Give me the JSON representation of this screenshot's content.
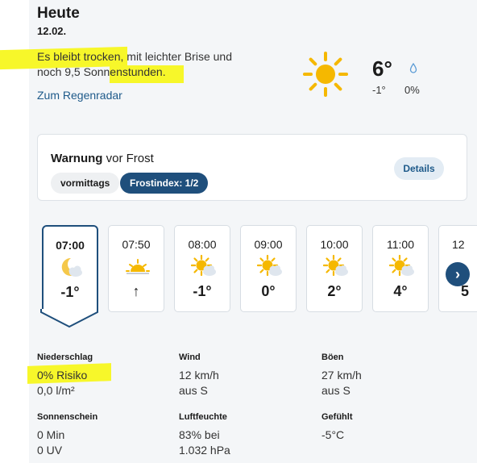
{
  "header": {
    "title": "Heute",
    "date": "12.02."
  },
  "summary": {
    "text_a": "Es bleibt trocken, mit leichter Brise und",
    "text_b": "noch ",
    "text_c": "9,5 Sonnenstunden.",
    "radar_link": "Zum Regenradar"
  },
  "current": {
    "temp": "6°",
    "min": "-1°",
    "precip": "0%",
    "icon": "sun-icon"
  },
  "warning": {
    "title_bold": "Warnung",
    "title_rest": " vor Frost",
    "chip_time": "vormittags",
    "chip_index": "Frostindex: 1/2",
    "details_label": "Details"
  },
  "hourly": [
    {
      "time": "07:00",
      "temp": "-1°",
      "icon": "moon-cloud-icon",
      "selected": true
    },
    {
      "time": "07:50",
      "temp": "↑",
      "icon": "sunrise-icon",
      "selected": false
    },
    {
      "time": "08:00",
      "temp": "-1°",
      "icon": "sun-cloud-icon",
      "selected": false
    },
    {
      "time": "09:00",
      "temp": "0°",
      "icon": "sun-cloud-icon",
      "selected": false
    },
    {
      "time": "10:00",
      "temp": "2°",
      "icon": "sun-cloud-icon",
      "selected": false
    },
    {
      "time": "11:00",
      "temp": "4°",
      "icon": "sun-cloud-icon",
      "selected": false
    },
    {
      "time": "12",
      "temp": "5",
      "icon": "sun-cloud-icon",
      "selected": false
    }
  ],
  "next_button": "›",
  "details": {
    "niederschlag": {
      "label": "Niederschlag",
      "line1": "0% Risiko",
      "line2": "0,0 l/m²"
    },
    "wind": {
      "label": "Wind",
      "line1": "12 km/h",
      "line2": "aus S"
    },
    "boeen": {
      "label": "Böen",
      "line1": "27 km/h",
      "line2": "aus S"
    },
    "sonnenschein": {
      "label": "Sonnenschein",
      "line1": "0 Min",
      "line2": "0 UV"
    },
    "luftfeuchte": {
      "label": "Luftfeuchte",
      "line1": "83% bei",
      "line2": "1.032 hPa"
    },
    "gefuehlt": {
      "label": "Gefühlt",
      "line1": "-5°C"
    }
  },
  "colors": {
    "accent": "#1f4f7c",
    "link": "#1e5a8a",
    "sun": "#f5b800",
    "highlight": "#f7f72a"
  }
}
